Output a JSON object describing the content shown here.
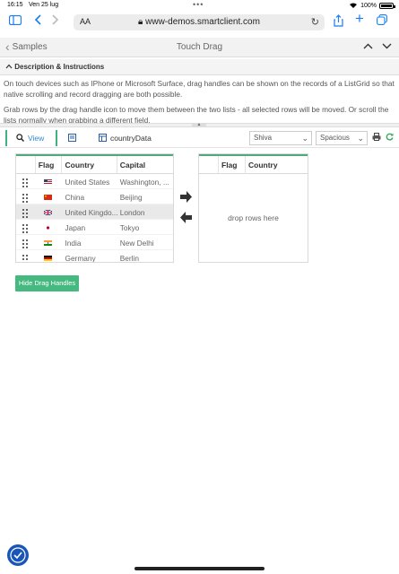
{
  "status_bar": {
    "time": "16:15",
    "date": "Ven 25 lug",
    "battery": "100%"
  },
  "safari": {
    "text_size": "AA",
    "url": "www-demos.smartclient.com"
  },
  "header": {
    "back_label": "Samples",
    "title": "Touch Drag"
  },
  "description": {
    "heading": "Description & Instructions",
    "para1": "On touch devices such as IPhone or Microsoft Surface, drag handles can be shown on the records of a ListGrid so that native scrolling and record dragging are both possible.",
    "para2": "Grab rows by the drag handle icon to move them between the two lists - all selected rows will be moved. Or scroll the lists normally when grabbing a different field."
  },
  "toolbar": {
    "view_label": "View",
    "datasource_label": "countryData",
    "skin_value": "Shiva",
    "density_value": "Spacious"
  },
  "left_grid": {
    "columns": [
      "Flag",
      "Country",
      "Capital"
    ],
    "rows": [
      {
        "country": "United States",
        "capital": "Washington, ..."
      },
      {
        "country": "China",
        "capital": "Beijing"
      },
      {
        "country": "United Kingdo...",
        "capital": "London"
      },
      {
        "country": "Japan",
        "capital": "Tokyo"
      },
      {
        "country": "India",
        "capital": "New Delhi"
      },
      {
        "country": "Germany",
        "capital": "Berlin"
      }
    ]
  },
  "right_grid": {
    "columns": [
      "Flag",
      "Country"
    ],
    "empty_message": "drop rows here"
  },
  "buttons": {
    "hide_drag_handles": "Hide Drag Handles"
  },
  "colors": {
    "accent": "#45b980",
    "ios_blue": "#1a7cf5"
  }
}
